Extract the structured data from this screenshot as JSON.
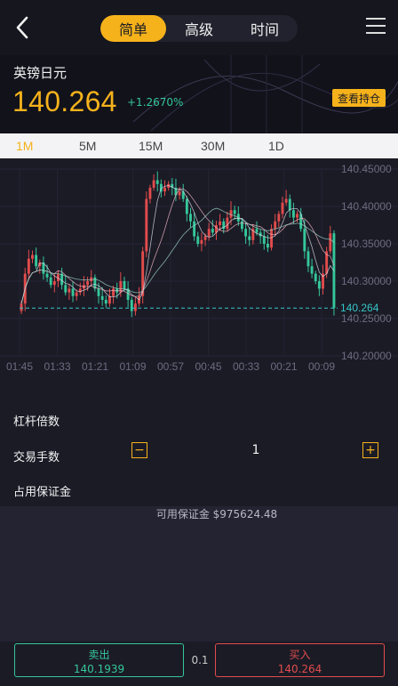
{
  "header": {
    "tabs": [
      {
        "label": "简单",
        "active": true
      },
      {
        "label": "高级",
        "active": false
      },
      {
        "label": "时间",
        "active": false
      }
    ]
  },
  "quote": {
    "symbol": "英镑日元",
    "price": "140.264",
    "change_pct": "+1.2670%",
    "hold_button": "查看持仓"
  },
  "periods": [
    {
      "label": "1M",
      "active": true
    },
    {
      "label": "5M",
      "active": false
    },
    {
      "label": "15M",
      "active": false
    },
    {
      "label": "30M",
      "active": false
    },
    {
      "label": "1D",
      "active": false
    }
  ],
  "chart_data": {
    "type": "candlestick",
    "ylim": [
      140.2,
      140.45
    ],
    "y_ticks": [
      "140.45000",
      "140.40000",
      "140.35000",
      "140.30000",
      "140.25000",
      "140.20000"
    ],
    "x_ticks": [
      "01:45",
      "01:33",
      "01:21",
      "01:09",
      "00:57",
      "00:45",
      "00:33",
      "00:21",
      "00:09"
    ],
    "current_price_label": "140.264",
    "current_price": 140.264,
    "close_series": [
      140.27,
      140.31,
      140.33,
      140.335,
      140.32,
      140.325,
      140.31,
      140.305,
      140.295,
      140.3,
      140.31,
      140.295,
      140.285,
      140.29,
      140.28,
      140.285,
      140.29,
      140.295,
      140.3,
      140.305,
      140.29,
      140.28,
      140.275,
      140.27,
      140.28,
      140.29,
      140.285,
      140.3,
      140.29,
      140.275,
      140.26,
      140.27,
      140.28,
      140.34,
      140.41,
      140.425,
      140.435,
      140.43,
      140.42,
      140.425,
      140.43,
      140.425,
      140.415,
      140.42,
      140.41,
      140.39,
      140.38,
      140.36,
      140.35,
      140.355,
      140.36,
      140.37,
      140.365,
      140.375,
      140.38,
      140.37,
      140.385,
      140.395,
      140.39,
      140.38,
      140.37,
      140.36,
      140.355,
      140.37,
      140.365,
      140.36,
      140.35,
      140.345,
      140.37,
      140.38,
      140.39,
      140.405,
      140.41,
      140.395,
      140.385,
      140.39,
      140.37,
      140.34,
      140.32,
      140.31,
      140.3,
      140.29,
      140.31,
      140.34,
      140.364,
      140.264
    ],
    "colors": {
      "up": "#e14c4c",
      "down": "#35c79a",
      "ma1": "#d9d9e6",
      "ma2": "#f2b6c6",
      "ma3": "#9fd6c8"
    }
  },
  "params": {
    "leverage_label": "杠杆倍数",
    "lots_label": "交易手数",
    "lots_value": "1",
    "minus_icon": "minus-icon",
    "plus_icon": "plus-icon",
    "margin_label": "占用保证金",
    "available_margin": "可用保证金 $975624.48"
  },
  "bottom": {
    "sell_label": "卖出",
    "sell_price": "140.1939",
    "spread": "0.1",
    "buy_label": "买入",
    "buy_price": "140.264"
  },
  "colors": {
    "accent": "#f5b21b",
    "up": "#e14c4c",
    "down": "#35c79a",
    "bg": "#1b1b26"
  }
}
